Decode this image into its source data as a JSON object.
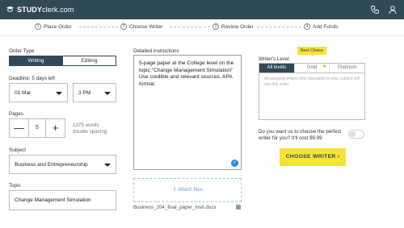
{
  "brand": {
    "prefix": "STUDY",
    "suffix": "clerk.com"
  },
  "topbar": {
    "icons": [
      "phone-icon",
      "user-icon"
    ]
  },
  "steps": [
    {
      "num": "1",
      "label": "Place Order"
    },
    {
      "num": "2",
      "label": "Choose Writer"
    },
    {
      "num": "3",
      "label": "Review Order"
    },
    {
      "num": "4",
      "label": "Add Funds"
    }
  ],
  "order_type": {
    "label": "Order Type",
    "writing": "Writing",
    "editing": "Editing",
    "selected": "Writing"
  },
  "deadline": {
    "label": "Deadline: 5 days left",
    "date": "01 Mar",
    "time": "3 PM"
  },
  "pages": {
    "label": "Pages",
    "value": "5",
    "minus": "—",
    "plus": "+",
    "words_line1": "1375 words",
    "words_line2": "double spacing"
  },
  "subject": {
    "label": "Subject",
    "value": "Business and Entrepreneurship"
  },
  "topic": {
    "label": "Topic",
    "value": "Change Management Simulation"
  },
  "instructions": {
    "label": "Detailed instructions",
    "text": "5-page paper at the College level on the topic \"Change Management Simulation\" Use credible and relevant sources. APA format."
  },
  "attach": {
    "label": "Attach files",
    "file_name": "Business_204_final_paper_instr.docx"
  },
  "writer_level": {
    "label": "Writer's Level",
    "badge": "Best Choice",
    "tabs": [
      "All levels",
      "Gold",
      "Platinum"
    ],
    "selected": "All levels",
    "description": "All amazing writers who specialize in your subject will see this order."
  },
  "perfect_writer": {
    "question": "Do you want us to choose the perfect writer for you? It'll cost $9.99",
    "enabled": false
  },
  "cta": {
    "label": "CHOOSE WRITER  ›"
  },
  "colors": {
    "topbar": "#2f4a55",
    "accent": "#f6e13a",
    "link": "#6a9fd8"
  }
}
